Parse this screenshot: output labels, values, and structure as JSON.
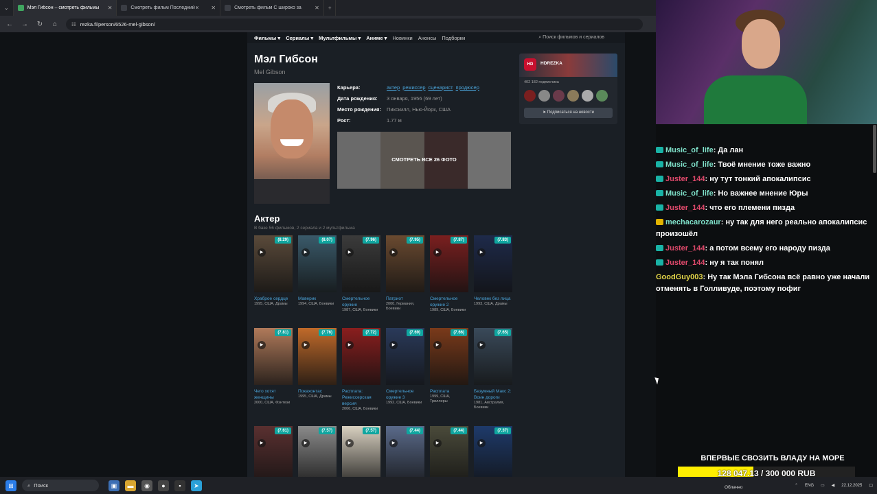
{
  "browser": {
    "tabs": [
      {
        "label": "Мэл Гибсон – смотреть фильмы",
        "active": true
      },
      {
        "label": "Смотреть фильм Последний к",
        "active": false
      },
      {
        "label": "Смотреть фильм С широко за",
        "active": false
      }
    ],
    "new_tab": "+",
    "url": "rezka.fi/person/6526-mel-gibson/"
  },
  "site": {
    "nav": [
      "Фильмы ▾",
      "Сериалы ▾",
      "Мультфильмы ▾",
      "Аниме ▾",
      "Новинки",
      "Анонсы",
      "Подборки"
    ],
    "search_placeholder": "Поиск фильмов и сериалов",
    "person": {
      "name": "Мэл Гибсон",
      "name_en": "Mel Gibson",
      "career_label": "Карьера:",
      "career": [
        "актер",
        "режиссер",
        "сценарист",
        "продюсер"
      ],
      "birth_label": "Дата рождения:",
      "birth": "3 января, 1956 (69 лет)",
      "place_label": "Место рождения:",
      "place": "Пикскилл, Нью-Йорк, США",
      "height_label": "Рост:",
      "height": "1.77 м",
      "photos_button": "СМОТРЕТЬ ВСЕ 26 ФОТО"
    },
    "telegram": {
      "logo": "HD",
      "name": "HDREZKA",
      "subscribers": "402 182 подписчика",
      "subscribe": "Подписаться на новости"
    },
    "section": {
      "title": "Актер",
      "subtitle": "В базе 56 фильмов, 2 сериала и 2 мультфильма"
    },
    "films": [
      {
        "rating": "(8.29)",
        "title": "Храброе сердце",
        "meta": "1995, США, Драмы",
        "color": "#5a4a3a"
      },
      {
        "rating": "(8.07)",
        "title": "Маверик",
        "meta": "1994, США, Боевики",
        "color": "#3a5a6a"
      },
      {
        "rating": "(7.96)",
        "title": "Смертельное оружие",
        "meta": "1987, США, Боевики",
        "color": "#3b3b3b"
      },
      {
        "rating": "(7.95)",
        "title": "Патриот",
        "meta": "2000, Германия, Боевики",
        "color": "#6a4a30"
      },
      {
        "rating": "(7.87)",
        "title": "Смертельное оружие 2",
        "meta": "1989, США, Боевики",
        "color": "#7a1f1f"
      },
      {
        "rating": "(7.83)",
        "title": "Человек без лица",
        "meta": "1993, США, Драмы",
        "color": "#1e2a4a"
      },
      {
        "rating": "(7.81)",
        "title": "Чего хотят женщины",
        "meta": "2000, США, Фэнтези",
        "color": "#b07a5a"
      },
      {
        "rating": "(7.76)",
        "title": "Покахонтас",
        "meta": "1995, США, Драмы",
        "color": "#c06a2a"
      },
      {
        "rating": "(7.72)",
        "title": "Расплата: Режиссерская версия",
        "meta": "2006, США, Боевики",
        "color": "#8a1e1e"
      },
      {
        "rating": "(7.69)",
        "title": "Смертельное оружие 3",
        "meta": "1992, США, Боевики",
        "color": "#2a3a5a"
      },
      {
        "rating": "(7.66)",
        "title": "Расплата",
        "meta": "1999, США, Триллеры",
        "color": "#7a3a1a"
      },
      {
        "rating": "(7.65)",
        "title": "Безумный Макс 2: Воин дороги",
        "meta": "1981, Австралия, Боевики",
        "color": "#3a4a5a"
      },
      {
        "rating": "(7.61)",
        "title": "",
        "meta": "",
        "color": "#5a3030"
      },
      {
        "rating": "(7.57)",
        "title": "",
        "meta": "",
        "color": "#8a8a8a"
      },
      {
        "rating": "(7.57)",
        "title": "",
        "meta": "",
        "color": "#d8d0c0"
      },
      {
        "rating": "(7.44)",
        "title": "",
        "meta": "",
        "color": "#5a6a8a"
      },
      {
        "rating": "(7.44)",
        "title": "",
        "meta": "",
        "color": "#4a4a3a"
      },
      {
        "rating": "(7.37)",
        "title": "",
        "meta": "",
        "color": "#1e3a6a"
      }
    ]
  },
  "chat": {
    "messages": [
      {
        "user": "Music_of_life",
        "color": "#7fe0c9",
        "text": ": Да лан",
        "badge": "sub"
      },
      {
        "user": "Music_of_life",
        "color": "#7fe0c9",
        "text": ": Твоё мнение тоже важно",
        "badge": "sub"
      },
      {
        "user": "Juster_144",
        "color": "#e0496b",
        "text": ": ну тут тонкий апокалипсис",
        "badge": "sub"
      },
      {
        "user": "Music_of_life",
        "color": "#7fe0c9",
        "text": ": Но важнее мнение Юры",
        "badge": "sub"
      },
      {
        "user": "Juster_144",
        "color": "#e0496b",
        "text": ": что его племени пизда",
        "badge": "sub"
      },
      {
        "user": "mechacarozaur",
        "color": "#7fe0c9",
        "text": ": ну так для него реально апокалипсис произошёл",
        "badge": "crown"
      },
      {
        "user": "Juster_144",
        "color": "#e0496b",
        "text": ": а потом всему его народу пизда",
        "badge": "sub"
      },
      {
        "user": "Juster_144",
        "color": "#e0496b",
        "text": ": ну я так понял",
        "badge": "sub"
      },
      {
        "user": "GoodGuy003",
        "color": "#e6d84a",
        "text": ": Ну так Мэла Гибсона всё равно уже начали отменять в Голливуде, поэтому пофиг",
        "badge": "none"
      }
    ],
    "donation_title": "ВПЕРВЫЕ СВОЗИТЬ ВЛАДУ НА МОРЕ",
    "donation_amount": "128 047.13 / 300 000 RUB",
    "donation_progress": 0.427
  },
  "taskbar": {
    "search": "Поиск",
    "weather": "Облачно",
    "lang": "ENG",
    "date": "22.12.2025"
  }
}
